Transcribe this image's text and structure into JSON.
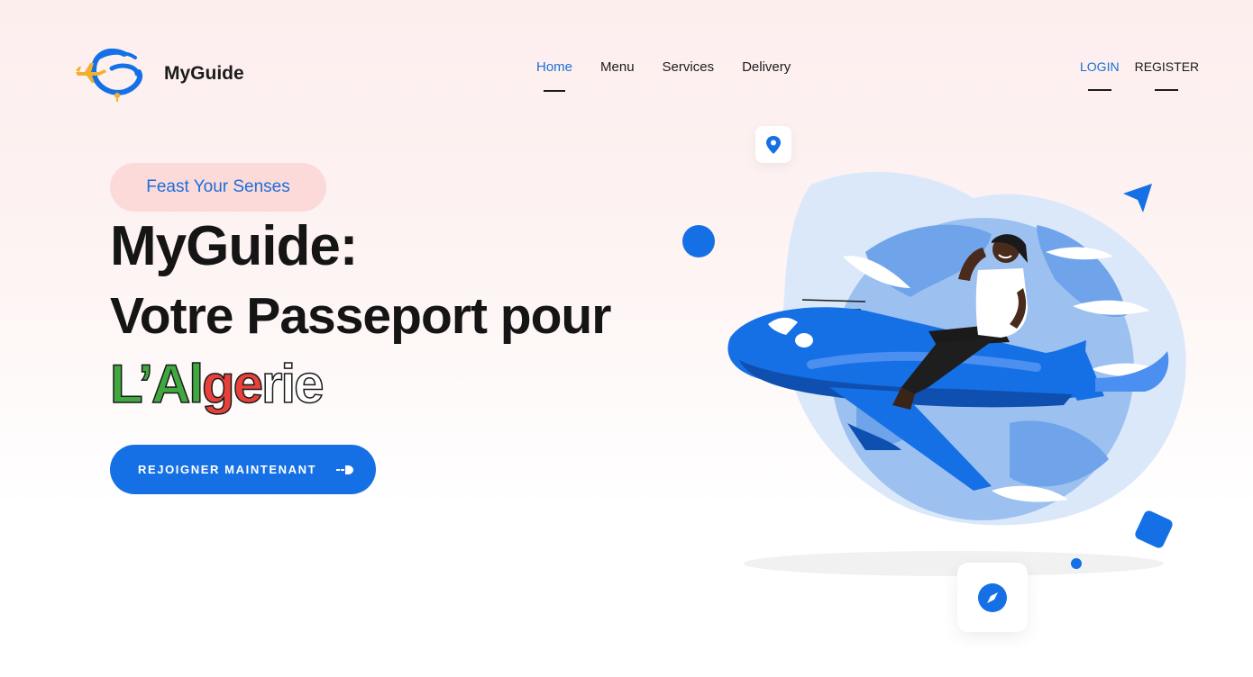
{
  "brand": {
    "name": "MyGuide",
    "logo_icon": "plane-globe-logo"
  },
  "nav": {
    "items": [
      {
        "label": "Home",
        "active": true
      },
      {
        "label": "Menu",
        "active": false
      },
      {
        "label": "Services",
        "active": false
      },
      {
        "label": "Delivery",
        "active": false
      }
    ]
  },
  "auth": {
    "login": "LOGIN",
    "register": "REGISTER"
  },
  "hero": {
    "badge": "Feast Your Senses",
    "title_line1": "MyGuide:",
    "title_line2": "Votre Passeport pour",
    "title_line3_parts": [
      "L’Al",
      "ge",
      "rie"
    ],
    "cta_label": "REJOIGNER MAINTENANT",
    "cta_icon": "arrow-right-icon",
    "illustration": "person-riding-airplane-over-globe"
  },
  "colors": {
    "accent": "#1570e6",
    "badge_bg": "#fcdada",
    "algeria_green": "#3fa93f",
    "algeria_red": "#e8413a"
  }
}
